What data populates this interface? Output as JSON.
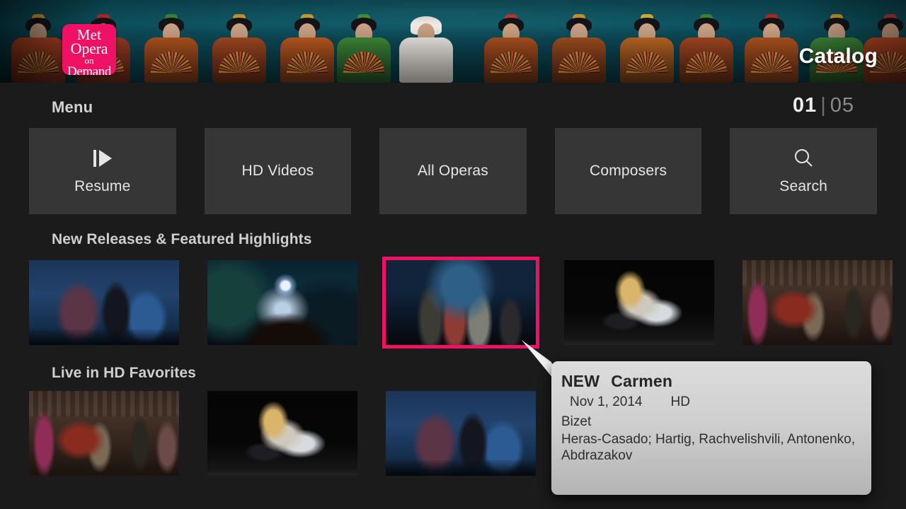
{
  "header": {
    "logo": {
      "line1": "Met",
      "line2": "Opera",
      "line3": "on",
      "line4": "Demand",
      "color": "#ef1164"
    },
    "title": "Catalog"
  },
  "menu": {
    "label": "Menu",
    "pager": {
      "current": "01",
      "separator": "|",
      "total": "05"
    },
    "items": [
      {
        "label": "Resume",
        "icon": "play-resume-icon"
      },
      {
        "label": "HD Videos",
        "icon": ""
      },
      {
        "label": "All Operas",
        "icon": ""
      },
      {
        "label": "Composers",
        "icon": ""
      },
      {
        "label": "Search",
        "icon": "search-icon"
      }
    ]
  },
  "sections": [
    {
      "title": "New Releases & Featured Highlights",
      "tiles": [
        {
          "art": "art-traviata",
          "name": "tile-traviata",
          "selected": false
        },
        {
          "art": "art-forest",
          "name": "tile-rusalka",
          "selected": false
        },
        {
          "art": "art-carmen",
          "name": "tile-carmen",
          "selected": true
        },
        {
          "art": "art-macbeth",
          "name": "tile-macbeth",
          "selected": false
        },
        {
          "art": "art-parlor",
          "name": "tile-parlor",
          "selected": false
        }
      ]
    },
    {
      "title": "Live in HD Favorites",
      "tiles": [
        {
          "art": "art-parlor",
          "name": "tile-parlor-2",
          "selected": false
        },
        {
          "art": "art-macbeth",
          "name": "tile-macbeth-2",
          "selected": false
        },
        {
          "art": "art-traviata",
          "name": "tile-traviata-2",
          "selected": false
        }
      ]
    }
  ],
  "tooltip": {
    "badge": "NEW",
    "title": "Carmen",
    "date": "Nov 1, 2014",
    "quality": "HD",
    "composer": "Bizet",
    "cast": "Heras-Casado; Hartig, Rachvelishvili, Antonenko, Abdrazakov"
  },
  "colors": {
    "accent": "#ef1164",
    "page_bg": "#1b1b1b",
    "button_bg": "#363636",
    "banner_bg": "#0c4f5a"
  }
}
